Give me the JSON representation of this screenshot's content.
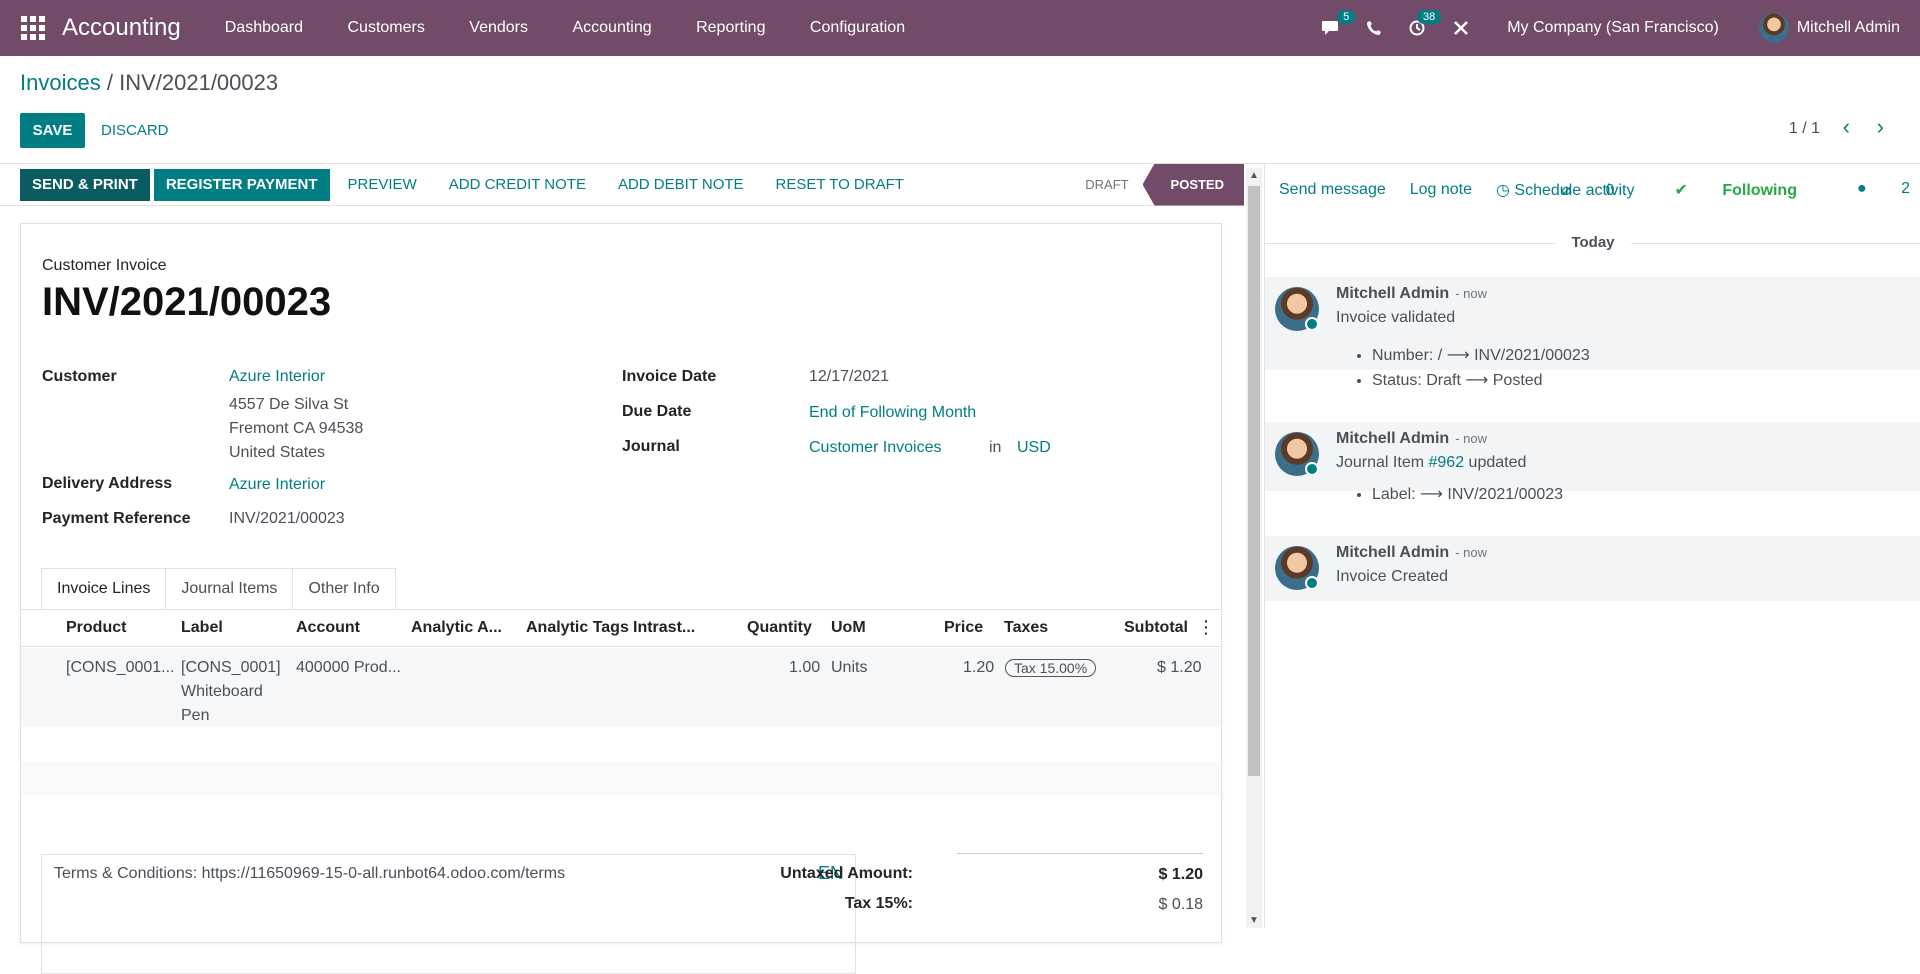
{
  "nav": {
    "app_name": "Accounting",
    "menu": [
      "Dashboard",
      "Customers",
      "Vendors",
      "Accounting",
      "Reporting",
      "Configuration"
    ],
    "messages_count": "5",
    "activities_count": "38",
    "company": "My Company (San Francisco)",
    "user": "Mitchell Admin",
    "icons": [
      "apps-icon",
      "chat-icon",
      "phone-icon",
      "activity-icon",
      "debug-icon"
    ]
  },
  "breadcrumb": {
    "parent": "Invoices",
    "separator": "/",
    "current": "INV/2021/00023"
  },
  "actions": {
    "save": "SAVE",
    "discard": "DISCARD"
  },
  "pager": {
    "text": "1 / 1",
    "prev": "‹",
    "next": "›"
  },
  "statusbar": {
    "buttons": [
      "SEND & PRINT",
      "REGISTER PAYMENT",
      "PREVIEW",
      "ADD CREDIT NOTE",
      "ADD DEBIT NOTE",
      "RESET TO DRAFT"
    ],
    "stages": [
      "DRAFT",
      "POSTED"
    ],
    "active_stage": "POSTED"
  },
  "invoice": {
    "type": "Customer Invoice",
    "number": "INV/2021/00023",
    "customer_label": "Customer",
    "customer_name": "Azure Interior",
    "address": [
      "4557 De Silva St",
      "Fremont CA 94538",
      "United States"
    ],
    "delivery_label": "Delivery Address",
    "delivery": "Azure Interior",
    "payref_label": "Payment Reference",
    "payref": "INV/2021/00023",
    "date_label": "Invoice Date",
    "date": "12/17/2021",
    "due_label": "Due Date",
    "due": "End of Following Month",
    "journal_label": "Journal",
    "journal": "Customer Invoices",
    "journal_in": "in",
    "currency": "USD"
  },
  "tabs": [
    "Invoice Lines",
    "Journal Items",
    "Other Info"
  ],
  "lines": {
    "columns": [
      "Product",
      "Label",
      "Account",
      "Analytic A...",
      "Analytic Tags",
      "Intrast...",
      "Quantity",
      "UoM",
      "Price",
      "Taxes",
      "Subtotal"
    ],
    "rows": [
      {
        "product": "[CONS_0001...",
        "label_1": "[CONS_0001]",
        "label_2": "Whiteboard",
        "label_3": "Pen",
        "account": "400000 Prod...",
        "quantity": "1.00",
        "uom": "Units",
        "price": "1.20",
        "tax": "Tax 15.00%",
        "subtotal": "$ 1.20"
      }
    ]
  },
  "terms": {
    "text": "Terms & Conditions: https://11650969-15-0-all.runbot64.odoo.com/terms",
    "lang": "EN"
  },
  "totals": {
    "untaxed_label": "Untaxed Amount:",
    "untaxed": "$ 1.20",
    "tax_label": "Tax 15%:",
    "tax": "$ 0.18"
  },
  "chatter": {
    "send_message": "Send message",
    "log_note": "Log note",
    "schedule": "Schedule activity",
    "attachments": "0",
    "following": "Following",
    "followers": "2",
    "today": "Today",
    "messages": [
      {
        "author": "Mitchell Admin",
        "when": "- now",
        "body": "Invoice validated",
        "items": [
          "Number: / ⟶ INV/2021/00023",
          "Status: Draft ⟶ Posted"
        ]
      },
      {
        "author": "Mitchell Admin",
        "when": "- now",
        "body_prefix": "Journal Item",
        "body_link": "#962",
        "body_suffix": "updated",
        "items": [
          "Label: ⟶ INV/2021/00023"
        ]
      },
      {
        "author": "Mitchell Admin",
        "when": "- now",
        "body": "Invoice Created",
        "items": []
      }
    ]
  }
}
